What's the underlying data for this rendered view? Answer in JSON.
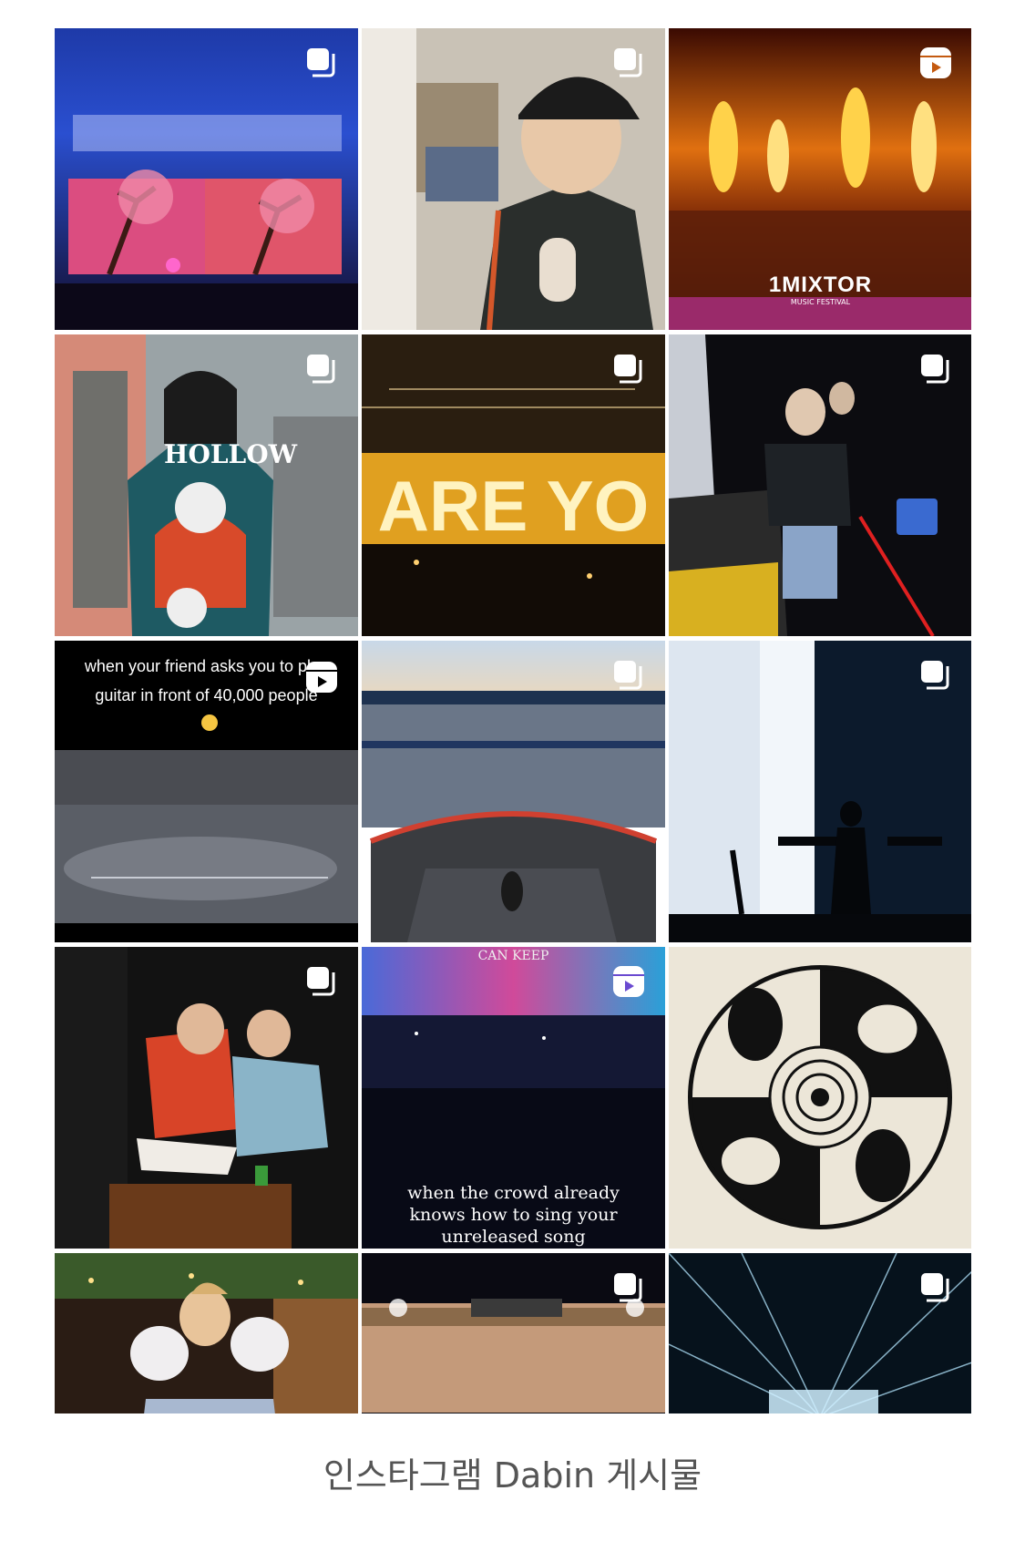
{
  "grid": {
    "tiles": [
      {
        "badge": "carousel-icon"
      },
      {
        "badge": "carousel-icon"
      },
      {
        "badge": "reels-icon",
        "overlay": "1MIXTOR",
        "overlay_sub": "MUSIC FESTIVAL"
      },
      {
        "badge": "carousel-icon",
        "overlay": "HOLLOW"
      },
      {
        "badge": "carousel-icon",
        "overlay": "ARE YO"
      },
      {
        "badge": "carousel-icon"
      },
      {
        "badge": "reels-icon",
        "overlay": "when your friend asks you to play guitar in front of 40,000 people"
      },
      {
        "badge": "carousel-icon"
      },
      {
        "badge": "carousel-icon"
      },
      {
        "badge": "carousel-icon"
      },
      {
        "badge": "reels-icon",
        "overlay": "when the crowd already knows how to sing your unreleased song",
        "overlay_top": "CAN KEEP"
      },
      {
        "badge": ""
      },
      {
        "badge": ""
      },
      {
        "badge": "carousel-icon"
      },
      {
        "badge": "carousel-icon"
      }
    ]
  },
  "caption": "인스타그램 Dabin 게시물"
}
